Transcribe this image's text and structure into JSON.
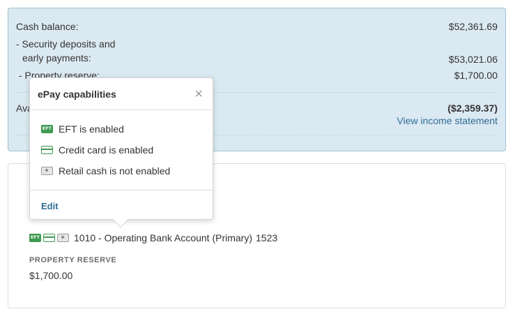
{
  "balance": {
    "cash_label": "Cash balance:",
    "cash_value": "$52,361.69",
    "deposits_label_line1": "- Security deposits and",
    "deposits_label_line2": "early payments:",
    "deposits_value": "$53,021.06",
    "reserve_label": "- Property reserve:",
    "reserve_value": "$1,700.00",
    "available_label": "Ava",
    "available_value": "($2,359.37)",
    "view_link": "View income statement"
  },
  "account": {
    "name": "1010 - Operating Bank Account (Primary)",
    "number": "1523",
    "reserve_heading": "PROPERTY RESERVE",
    "reserve_amount": "$1,700.00",
    "icons": [
      "eft-icon",
      "credit-card-icon",
      "cash-icon"
    ]
  },
  "popover": {
    "title": "ePay capabilities",
    "close": "×",
    "items": [
      {
        "icon": "eft-icon",
        "text": "EFT is enabled"
      },
      {
        "icon": "credit-card-icon",
        "text": "Credit card is enabled"
      },
      {
        "icon": "cash-icon",
        "text": "Retail cash is not enabled"
      }
    ],
    "edit_label": "Edit"
  },
  "icon_text": {
    "eft": "EFT"
  },
  "colors": {
    "panel": "#dbe9f2",
    "link": "#2f6d96",
    "enabled": "#3f9a52",
    "disabled": "#9a9a9a"
  }
}
